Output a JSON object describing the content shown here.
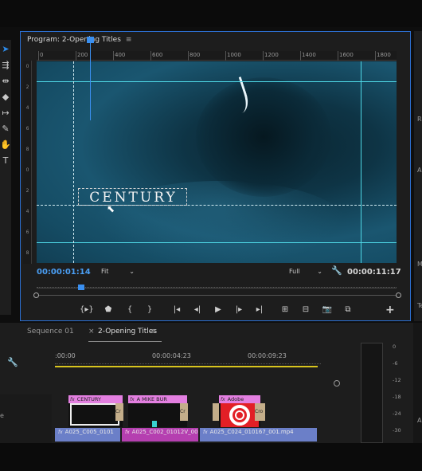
{
  "program_monitor": {
    "title": "Program: 2-Opening Titles",
    "menu_icon": "≡",
    "ruler_labels": [
      "0",
      "200",
      "400",
      "600",
      "800",
      "1000",
      "1200",
      "1400",
      "1600",
      "1800"
    ],
    "vruler_labels": [
      "0",
      "2",
      "4",
      "6",
      "8",
      "0",
      "2",
      "4",
      "6",
      "8"
    ],
    "overlay_text": "CENTURY",
    "current_timecode": "00:00:01:14",
    "duration_timecode": "00:00:11:17",
    "zoom_level": "Fit",
    "playback_resolution": "Full",
    "transport": {
      "mark_in": "{▸}",
      "add_marker": "⬟",
      "mark_in_bracket": "{",
      "mark_out_bracket": "}",
      "go_to_in": "|◂",
      "step_back": "◂|",
      "play": "▶",
      "step_forward": "|▸",
      "go_to_out": "▸|",
      "lift": "⊞",
      "extract": "⊟",
      "export_frame": "📷",
      "compare": "⧉",
      "add": "+"
    }
  },
  "tools": [
    {
      "name": "selection-tool-icon",
      "glyph": "➤",
      "active": true
    },
    {
      "name": "track-select-icon",
      "glyph": "⇶"
    },
    {
      "name": "ripple-edit-icon",
      "glyph": "⇹"
    },
    {
      "name": "razor-icon",
      "glyph": "◆"
    },
    {
      "name": "slip-icon",
      "glyph": "↦"
    },
    {
      "name": "pen-icon",
      "glyph": "✎"
    },
    {
      "name": "hand-icon",
      "glyph": "✋"
    },
    {
      "name": "type-icon",
      "glyph": "T"
    }
  ],
  "timeline": {
    "tabs": [
      {
        "label": "Sequence 01",
        "active": false
      },
      {
        "label": "2-Opening Titles",
        "active": true
      }
    ],
    "close_icon": "×",
    "menu_icon": "≡",
    "ruler_labels": [
      ":00:00",
      "00:00:04:23",
      "00:00:09:23"
    ],
    "track_label": "e",
    "v3_clips": [
      {
        "label": "CENTURY",
        "fx": "fx",
        "head_color": "#e37fe0",
        "thumb": "title"
      },
      {
        "label": "A MIKE BUR",
        "fx": "fx",
        "head_color": "#e37fe0",
        "thumb": "dark"
      },
      {
        "label": "Adobe",
        "fx": "fx",
        "head_color": "#e37fe0",
        "thumb": "adobe"
      }
    ],
    "side_tags": [
      "Cr",
      "Cr",
      "Cro"
    ],
    "v2_clips": [
      {
        "label": "A025_C005_0101",
        "fx": "fx",
        "color": "#6b7fc8"
      },
      {
        "label": "A025_C002_01012V_00",
        "fx": "fx",
        "color": "#b53fb0"
      },
      {
        "label": "A025_C024_010167_001.mp4",
        "fx": "fx",
        "color": "#6b7fc8"
      }
    ]
  },
  "audio_meter": {
    "labels": [
      "0",
      "-6",
      "-12",
      "-18",
      "-24",
      "-30"
    ]
  },
  "right_panel": {
    "labels": [
      "R",
      "A",
      "M",
      "Te",
      "A"
    ]
  },
  "colors": {
    "accent_blue": "#2d8ceb",
    "guide_cyan": "#4fd8e6",
    "work_area_yellow": "#d8c51e",
    "title_clip_pink": "#e37fe0"
  }
}
